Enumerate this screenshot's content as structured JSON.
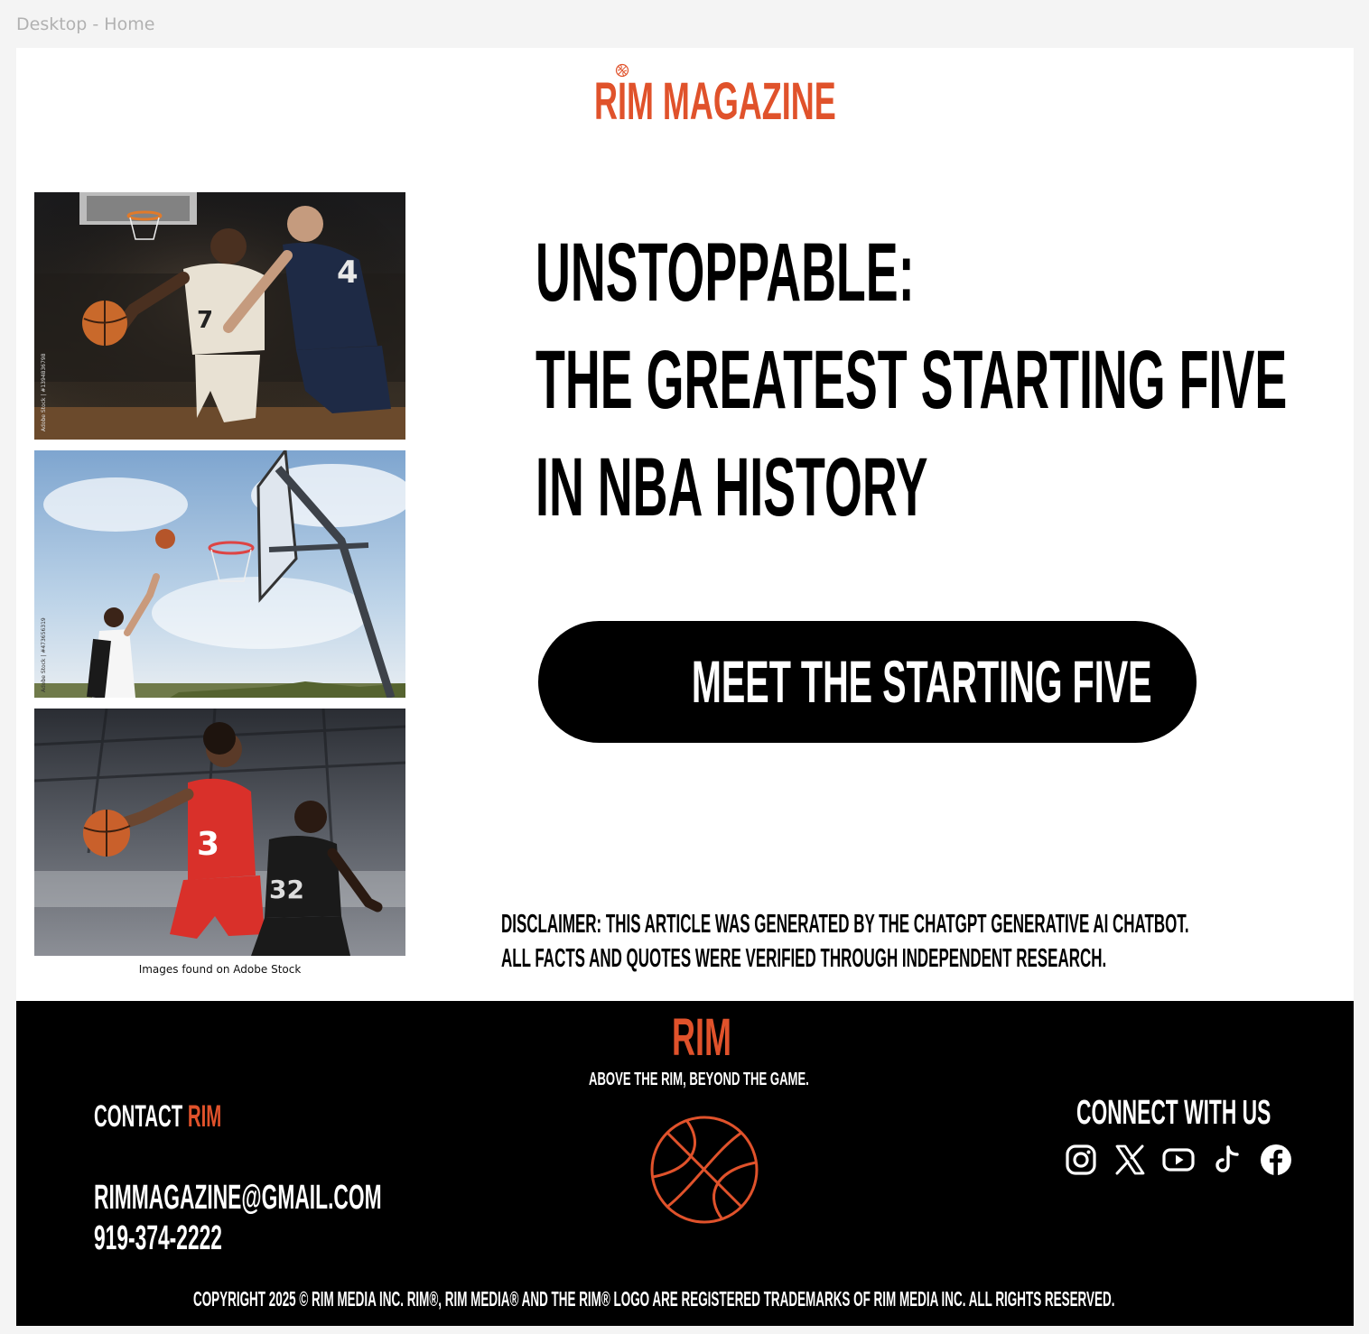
{
  "canvas": {
    "frame_label": "Desktop - Home"
  },
  "header": {
    "logo_text": "RIM MAGAZINE"
  },
  "gallery": {
    "caption": "Images found on Adobe Stock",
    "photos": [
      {
        "alt": "Two basketball players, number 7 dribbling against defender number 4 in an arena",
        "watermark": "Adobe Stock | #1394836798"
      },
      {
        "alt": "Young player shooting a basketball toward an outdoor hoop against a blue sky",
        "watermark": "Adobe Stock | #473656319"
      },
      {
        "alt": "Player in red jersey number 3 dribbling past defender in black jersey number 32 in a gym"
      }
    ]
  },
  "hero": {
    "headline_lines": [
      "UNSTOPPABLE:",
      "THE GREATEST STARTING FIVE",
      "IN NBA HISTORY"
    ],
    "cta_label": "MEET THE STARTING FIVE"
  },
  "disclaimer": {
    "lines": [
      "DISCLAIMER: THIS ARTICLE WAS GENERATED BY THE CHATGPT GENERATIVE AI CHATBOT.",
      "ALL FACTS AND QUOTES WERE VERIFIED THROUGH INDEPENDENT RESEARCH."
    ]
  },
  "footer": {
    "brand": "RIM",
    "tagline": "ABOVE THE RIM, BEYOND THE GAME.",
    "contact": {
      "heading_prefix": "CONTACT ",
      "heading_accent": "RIM",
      "email": "RIMMAGAZINE@GMAIL.COM",
      "phone": "919-374-2222"
    },
    "connect_heading": "CONNECT WITH US",
    "socials": [
      "instagram-icon",
      "x-icon",
      "youtube-icon",
      "tiktok-icon",
      "facebook-icon"
    ],
    "copyright": "COPYRIGHT 2025 © RIM MEDIA INC. RIM®, RIM MEDIA® AND THE RIM® LOGO ARE REGISTERED TRADEMARKS OF RIM MEDIA INC. ALL RIGHTS RESERVED."
  },
  "colors": {
    "accent": "#e0522b",
    "primary": "#000000",
    "background": "#ffffff",
    "canvas": "#f4f4f4"
  }
}
